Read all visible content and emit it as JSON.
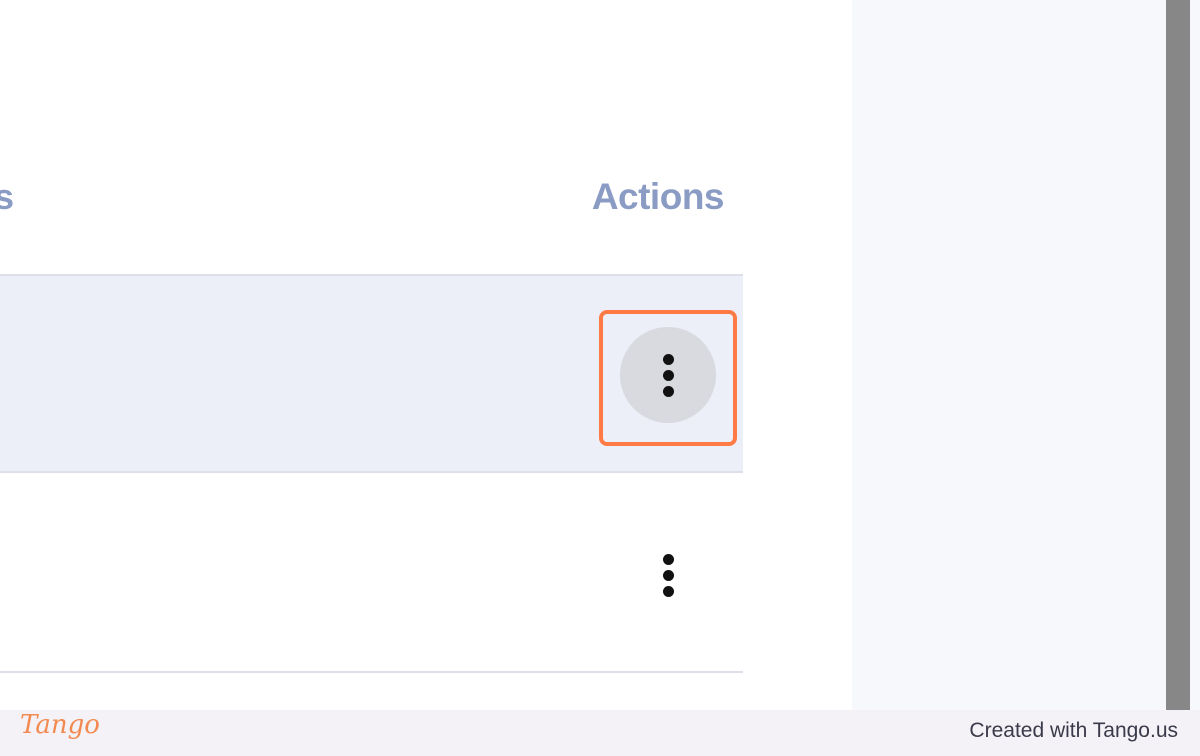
{
  "table": {
    "header_partial": "s",
    "header_actions": "Actions"
  },
  "rows": [
    {
      "state": "selected",
      "menu_icon": "more-vert-icon",
      "hovered": true
    },
    {
      "state": "normal",
      "menu_icon": "more-vert-icon",
      "hovered": false
    }
  ],
  "footer": {
    "logo_text": "Tango",
    "credit": "Created with Tango.us"
  },
  "colors": {
    "highlight": "#ff7a45",
    "header_text": "#8a9bc4",
    "selected_row": "#eceff7",
    "scrollbar": "#878787"
  }
}
